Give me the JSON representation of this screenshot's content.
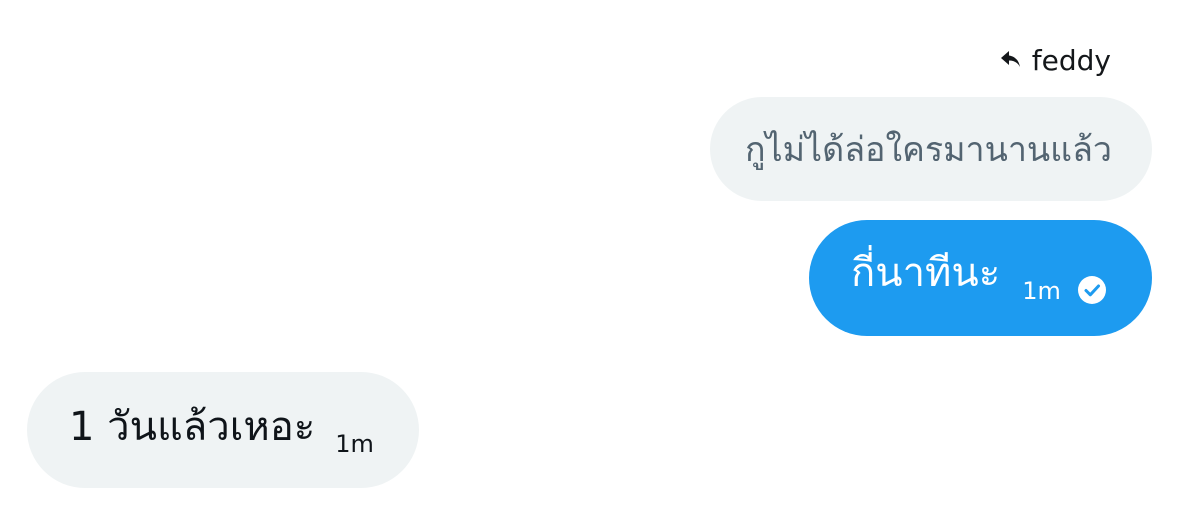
{
  "reply": {
    "icon": "reply-arrow-icon",
    "name": "feddy"
  },
  "messages": [
    {
      "type": "quoted",
      "text": "กูไม่ได้ล่อใครมานานแล้ว"
    },
    {
      "type": "sent",
      "text": "กี่นาทีนะ",
      "time": "1m",
      "status_icon": "check-circle-icon"
    },
    {
      "type": "received",
      "text": "1 วันแล้วเหอะ",
      "time": "1m"
    }
  ],
  "colors": {
    "sent_bubble": "#1d9bf0",
    "received_bubble": "#eff3f4",
    "quoted_text": "#536471",
    "text": "#0f1419"
  }
}
